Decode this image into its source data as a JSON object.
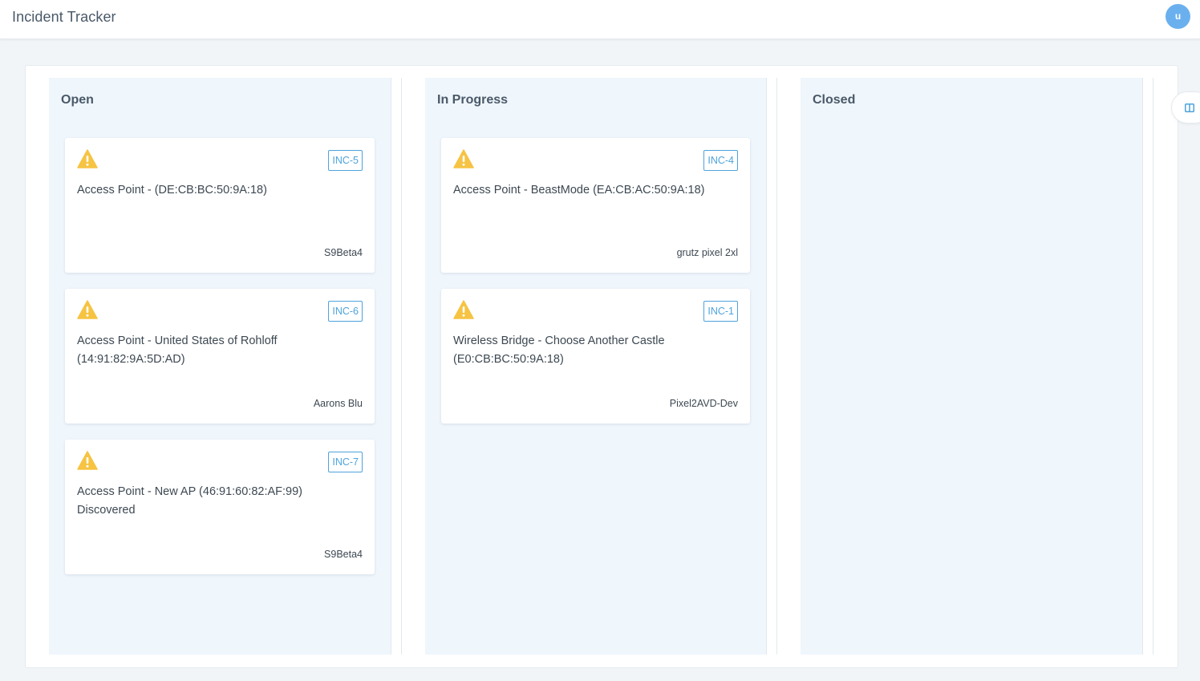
{
  "header": {
    "app_title": "Incident Tracker",
    "user_initial": "u"
  },
  "columns": [
    {
      "title": "Open",
      "cards": [
        {
          "id": "INC-5",
          "title": "Access Point - (DE:CB:BC:50:9A:18)",
          "device": "S9Beta4",
          "icon": "warning-icon"
        },
        {
          "id": "INC-6",
          "title": "Access Point - United States of Rohloff (14:91:82:9A:5D:AD)",
          "device": "Aarons Blu",
          "icon": "warning-icon"
        },
        {
          "id": "INC-7",
          "title": "Access Point - New AP (46:91:60:82:AF:99) Discovered",
          "device": "S9Beta4",
          "icon": "warning-icon"
        }
      ]
    },
    {
      "title": "In Progress",
      "cards": [
        {
          "id": "INC-4",
          "title": "Access Point - BeastMode (EA:CB:AC:50:9A:18)",
          "device": "grutz pixel 2xl",
          "icon": "warning-icon"
        },
        {
          "id": "INC-1",
          "title": "Wireless Bridge - Choose Another Castle (E0:CB:BC:50:9A:18)",
          "device": "Pixel2AVD-Dev",
          "icon": "warning-icon"
        }
      ]
    },
    {
      "title": "Closed",
      "cards": []
    }
  ],
  "side_panel_toggle": {
    "icon": "columns-icon"
  },
  "colors": {
    "accent": "#4ea3dc",
    "warning": "#f6c343",
    "column_bg": "#eff6fc",
    "page_bg": "#f2f5f8"
  }
}
